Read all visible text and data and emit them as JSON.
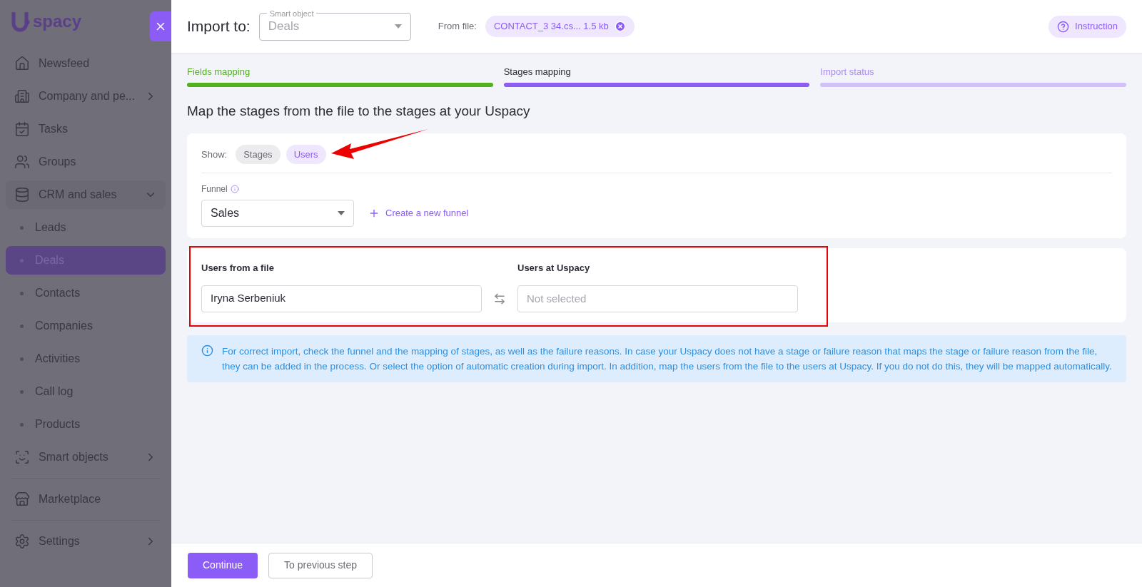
{
  "sidebar": {
    "logo": "spacy",
    "items": [
      {
        "label": "Newsfeed",
        "kind": "main",
        "arrow": false,
        "selected": false
      },
      {
        "label": "Company and pe...",
        "kind": "main",
        "arrow": true,
        "selected": false
      },
      {
        "label": "Tasks",
        "kind": "main",
        "arrow": false,
        "selected": false
      },
      {
        "label": "Groups",
        "kind": "main",
        "arrow": false,
        "selected": false
      },
      {
        "label": "CRM and sales",
        "kind": "group",
        "arrow": true,
        "expanded": true,
        "selected": false
      },
      {
        "label": "Leads",
        "kind": "sub",
        "selected": false
      },
      {
        "label": "Deals",
        "kind": "sub",
        "selected": true
      },
      {
        "label": "Contacts",
        "kind": "sub",
        "selected": false
      },
      {
        "label": "Companies",
        "kind": "sub",
        "selected": false
      },
      {
        "label": "Activities",
        "kind": "sub",
        "selected": false
      },
      {
        "label": "Call log",
        "kind": "sub",
        "selected": false
      },
      {
        "label": "Products",
        "kind": "sub",
        "selected": false
      },
      {
        "label": "Smart objects",
        "kind": "main",
        "arrow": true,
        "selected": false
      },
      {
        "label": "Marketplace",
        "kind": "main",
        "divider": true,
        "arrow": false,
        "selected": false
      },
      {
        "label": "Settings",
        "kind": "main",
        "divider": true,
        "arrow": true,
        "selected": false
      }
    ]
  },
  "header": {
    "title": "Import to:",
    "smart_object": {
      "label": "Smart object",
      "value": "Deals"
    },
    "from_file_label": "From file:",
    "file_chip": "CONTACT_3 34.cs... 1.5 kb",
    "instruction": "Instruction"
  },
  "steps": [
    {
      "label": "Fields mapping",
      "kind": "done"
    },
    {
      "label": "Stages mapping",
      "kind": "current"
    },
    {
      "label": "Import status",
      "kind": "upcoming"
    }
  ],
  "heading": "Map the stages from the file to the stages at your Uspacy",
  "show": {
    "label": "Show:",
    "options": [
      {
        "label": "Stages",
        "selected": false
      },
      {
        "label": "Users",
        "selected": true
      }
    ]
  },
  "funnel": {
    "label": "Funnel",
    "value": "Sales",
    "create_link": "Create a new funnel"
  },
  "users": {
    "from_header": "Users from a file",
    "to_header": "Users at Uspacy",
    "rows": [
      {
        "from": "Iryna Serbeniuk",
        "to_placeholder": "Not selected"
      }
    ]
  },
  "info": "For correct import, check the funnel and the mapping of stages, as well as the failure reasons. In case your Uspacy does not have a stage or failure reason that maps the stage or failure reason from the file, they can be added in the process. Or select the option of automatic creation during import. In addition, map the users from the file to the users at Uspacy. If you do not do this, they will be mapped automatically.",
  "footer": {
    "continue": "Continue",
    "previous": "To previous step"
  }
}
